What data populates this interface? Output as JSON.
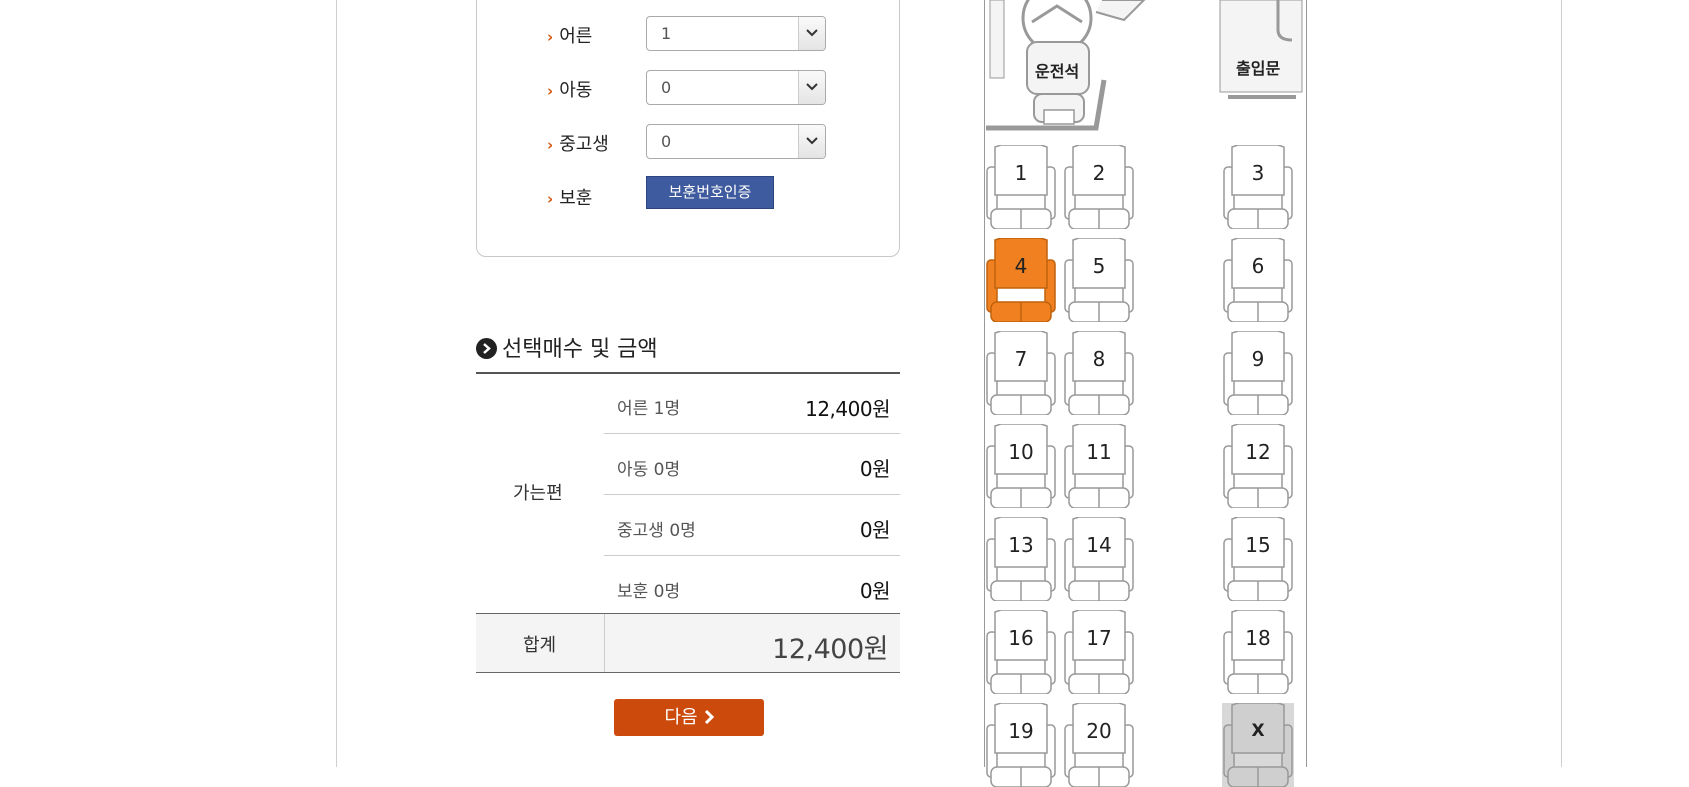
{
  "passengers": {
    "adult": {
      "label": "어른",
      "value": "1"
    },
    "child": {
      "label": "아동",
      "value": "0"
    },
    "student": {
      "label": "중고생",
      "value": "0"
    },
    "veteran": {
      "label": "보훈",
      "button": "보훈번호인증"
    }
  },
  "summary": {
    "title": "선택매수 및 금액",
    "direction": "가는편",
    "rows": [
      {
        "name": "어른 1명",
        "amount": "12,400원"
      },
      {
        "name": "아동 0명",
        "amount": "0원"
      },
      {
        "name": "중고생 0명",
        "amount": "0원"
      },
      {
        "name": "보훈 0명",
        "amount": "0원"
      }
    ],
    "total_label": "합계",
    "total_amount": "12,400원",
    "next_button": "다음"
  },
  "bus": {
    "driver_label": "운전석",
    "door_label": "출입문",
    "seats": [
      "1",
      "2",
      "3",
      "4",
      "5",
      "6",
      "7",
      "8",
      "9",
      "10",
      "11",
      "12",
      "13",
      "14",
      "15",
      "16",
      "17",
      "18",
      "19",
      "20",
      "X"
    ],
    "selected_seat": "4",
    "unavailable_seat": "X"
  },
  "colors": {
    "accent": "#cc4b0c",
    "selected_seat": "#f08020",
    "verify_button": "#3f5b9f",
    "unavailable_seat": "#cfcfcf"
  }
}
